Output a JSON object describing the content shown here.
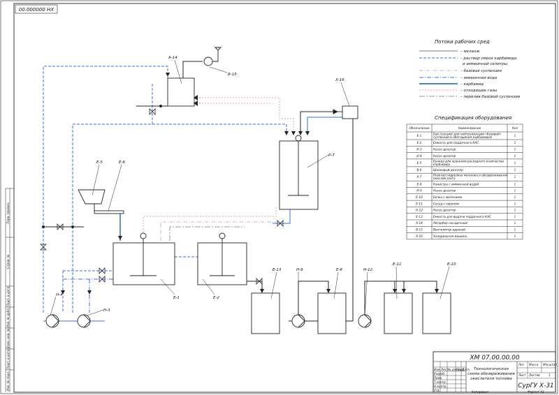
{
  "stamp": "00.000000 НХ",
  "legend": {
    "title": "Потоки рабочих сред",
    "items": [
      {
        "label": "– меланж",
        "color": "#777777",
        "dash": ""
      },
      {
        "label": "– раствор смеси карбамида",
        "label2": "и аммиачной селитры",
        "color": "#3a6fd8",
        "dash": "4 2"
      },
      {
        "label": "– базовая суспензия",
        "color": "#b8b8b8",
        "dash": "5 2 1 2"
      },
      {
        "label": "– аммиачная вода",
        "color": "#3a6fd8",
        "dash": "6 2 1 2"
      },
      {
        "label": "– карбамид",
        "color": "#1f5fae",
        "dash": ""
      },
      {
        "label": "– отходящие газы",
        "color": "#e9a3a3",
        "dash": "2 2"
      },
      {
        "label": "– перелив базовой суспензии",
        "color": "#999999",
        "dash": "8 2 2 2"
      }
    ]
  },
  "spec": {
    "title": "Спецификация оборудования",
    "headers": [
      "Обозначение",
      "Наименование",
      "Кол"
    ],
    "rows": [
      [
        "Е-1",
        "Бак (секция) для нейтрализации «базовой» суспензии и обогащения карбамидом",
        "1"
      ],
      [
        "Е-2",
        "Емкость для поддачного КАС",
        "1"
      ],
      [
        "Н-3",
        "Насос-дозатор",
        "1"
      ],
      [
        "Н-4",
        "Насос-дозатор",
        "1"
      ],
      [
        "Е-5",
        "Бункер для хранения расходного количества карбамида",
        "1"
      ],
      [
        "В-6",
        "Шнековый дозатор",
        "1"
      ],
      [
        "Р-7",
        "Реактор гидролиза меланжа и обезвреживания окислов азота",
        "1"
      ],
      [
        "Е-8",
        "Канистра с аммиачной водой",
        "1"
      ],
      [
        "Н-9",
        "Насос-дозатор",
        "1"
      ],
      [
        "Е-10",
        "Бочка с меланжем",
        "1"
      ],
      [
        "Е-11",
        "Сосуд с сиропом",
        "1"
      ],
      [
        "Н-12",
        "Насос-дозатор",
        "1"
      ],
      [
        "Е-13",
        "Емкость для выдачи поддачного КАС",
        "1"
      ],
      [
        "А-14",
        "Абсорбер насадочный",
        "1"
      ],
      [
        "В-15",
        "Вентилятор вдувной",
        "1"
      ],
      [
        "Х-16",
        "Холодильная машина",
        "1"
      ]
    ]
  },
  "labels": {
    "a14": "А-14",
    "b15": "В-15",
    "x16": "Х-16",
    "p7": "Р-7",
    "e5": "Е-5",
    "e6": "Е-6",
    "e1": "Е-1",
    "e2": "Е-2",
    "n4": "Н-4",
    "n3": "Н-3",
    "e13": "Е-13",
    "n9": "Н-9",
    "e8": "Е-8",
    "n12": "Н-12",
    "e11": "Е-11",
    "e10": "Е-10"
  },
  "title_block": {
    "doc_number": "ХМ 07.00.00.00",
    "title_line1": "Технологическая",
    "title_line2": "схема обезвреживания",
    "title_line3": "окислителя топлива",
    "org": "СурГУ  Х-31",
    "lit": "Лит",
    "mass": "Масса",
    "scale": "Масштаб",
    "sheet": "Лист",
    "sheets": "Листов",
    "sheets_count": "1",
    "copied": "Копировал",
    "format": "Формат    А1",
    "col_izm": "Изм.",
    "col_list": "Лист",
    "col_doc": "№ докум.",
    "col_podp": "Подп.",
    "col_data": "Дата",
    "row_razrab": "Разраб.",
    "row_prov": "Пров.",
    "row_tkontr": "Т.контр.",
    "row_nkontr": "Н.контр.",
    "row_utv": "Утв."
  },
  "side_labels": [
    "Перв. примен.",
    "Справ. №",
    "Подп. и дата",
    "Инв. № дубл.",
    "Взам. инв. №",
    "Подп. и дата",
    "Инв. № подл."
  ]
}
